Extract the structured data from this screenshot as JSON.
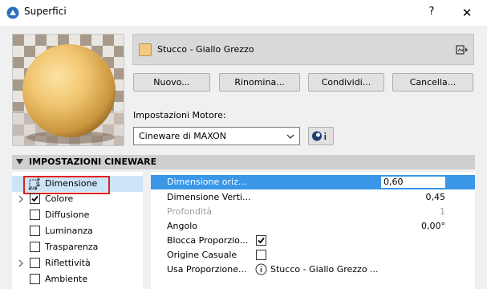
{
  "window": {
    "title": "Superfici",
    "help_label": "?",
    "close_label": "✕"
  },
  "material": {
    "name": "Stucco - Giallo Grezzo",
    "swatch_color": "#f4c97f"
  },
  "buttons": {
    "new": "Nuovo...",
    "rename": "Rinomina...",
    "share": "Condividi...",
    "delete": "Cancella..."
  },
  "engine": {
    "label": "Impostazioni Motore:",
    "selected": "Cineware di MAXON"
  },
  "section": {
    "title": "IMPOSTAZIONI CINEWARE"
  },
  "channels": [
    {
      "label": "Dimensione"
    },
    {
      "label": "Colore"
    },
    {
      "label": "Diffusione"
    },
    {
      "label": "Luminanza"
    },
    {
      "label": "Trasparenza"
    },
    {
      "label": "Riflettività"
    },
    {
      "label": "Ambiente"
    }
  ],
  "properties": [
    {
      "label": "Dimensione oriz...",
      "value": "0,60"
    },
    {
      "label": "Dimensione Verti...",
      "value": "0,45"
    },
    {
      "label": "Profondità",
      "value": "1"
    },
    {
      "label": "Angolo",
      "value": "0,00°"
    },
    {
      "label": "Blocca Proporzio..."
    },
    {
      "label": "Origine Casuale"
    },
    {
      "label": "Usa Proporzione...",
      "link": "Stucco - Giallo Grezzo ..."
    }
  ],
  "colors": {
    "selection_blue": "#3a97e8",
    "list_selection": "#cce4f7",
    "highlight_red": "#e0201c"
  }
}
